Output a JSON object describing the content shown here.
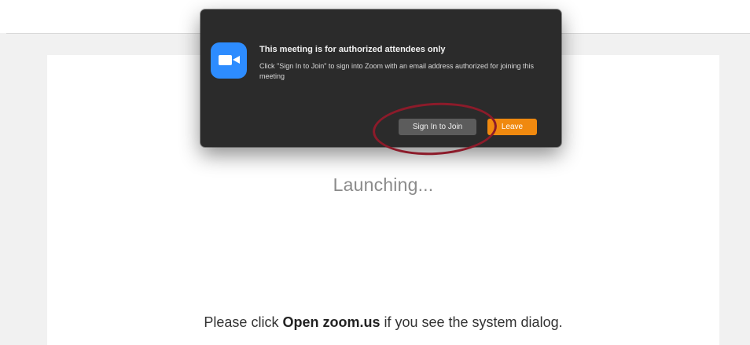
{
  "page": {
    "status_text": "Launching...",
    "instruction_prefix": "Please click ",
    "instruction_bold": "Open zoom.us",
    "instruction_suffix": " if you see the system dialog."
  },
  "dialog": {
    "icon": "zoom-camera-icon",
    "title": "This meeting is for authorized attendees only",
    "message": "Click \"Sign In to Join\" to sign into Zoom with an email address authorized for joining this meeting",
    "sign_in_label": "Sign In to Join",
    "leave_label": "Leave"
  },
  "colors": {
    "dialog_background": "#2b2b2b",
    "zoom_blue": "#2d8cff",
    "leave_orange": "#f0890f",
    "annotation_red": "#8c1b2a"
  }
}
